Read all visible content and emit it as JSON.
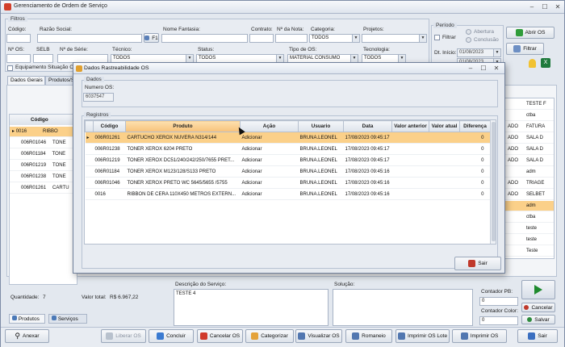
{
  "window": {
    "title": "Gerenciamento de Ordem de Serviço"
  },
  "filters": {
    "group_label": "Filtros",
    "codigo_label": "Código:",
    "razao_social_label": "Razão Social:",
    "f1_label": "F1",
    "nome_fantasia_label": "Nome Fantasia:",
    "contrato_label": "Contrato:",
    "nota_label": "Nº da Nota:",
    "categoria_label": "Categoria:",
    "categoria_value": "TODOS",
    "projetos_label": "Projetos:",
    "os_label": "Nº OS:",
    "selb_label": "SELB",
    "serie_label": "Nº de Série:",
    "tecnico_label": "Técnico:",
    "tecnico_value": "TODOS",
    "status_label": "Status:",
    "status_value": "TODOS",
    "tipo_os_label": "Tipo de OS:",
    "tipo_os_value": "MATERIAL CONSUMO",
    "tecnologia_label": "Tecnologia:",
    "tecnologia_value": "TODOS",
    "equipamento_checkbox_label": "Equipamento Situação C..."
  },
  "periodo": {
    "group_label": "Período",
    "filtrar_label": "Filtrar",
    "abertura_label": "Abertura",
    "conclusao_label": "Conclusão",
    "dt_inicio_label": "Dt. Início:",
    "dt_inicio_value": "01/08/2023",
    "dt_fim_value": "01/08/2023"
  },
  "toolbar_right": {
    "abrir_os_label": "Abrir OS",
    "filtrar_label": "Filtrar"
  },
  "main_tabs": [
    "Dados Gerais",
    "Produtos/Se..."
  ],
  "background_list": {
    "header": "Código",
    "rows": [
      {
        "code": "0016",
        "prod": "RIBBO"
      },
      {
        "code": "006R01046",
        "prod": "TONE"
      },
      {
        "code": "006R01184",
        "prod": "TONE"
      },
      {
        "code": "006R01219",
        "prod": "TONE"
      },
      {
        "code": "006R01238",
        "prod": "TONE"
      },
      {
        "code": "006R01261",
        "prod": "CARTU"
      }
    ],
    "quantidade_label": "Quantidade:",
    "quantidade_value": "7",
    "valor_total_label": "Valor total:",
    "valor_total_value": "R$ 6.967,22"
  },
  "right_list": {
    "rows": [
      {
        "col1": "",
        "col2": "TESTE F"
      },
      {
        "col1": "",
        "col2": "ctba"
      },
      {
        "col1": "ADO",
        "col2": "FATURA"
      },
      {
        "col1": "ADO",
        "col2": "SALA D"
      },
      {
        "col1": "ADO",
        "col2": "SALA D"
      },
      {
        "col1": "ADO",
        "col2": "SALA D"
      },
      {
        "col1": "",
        "col2": "adm"
      },
      {
        "col1": "ADO",
        "col2": "TRIAGE"
      },
      {
        "col1": "ADO",
        "col2": "SELBET"
      },
      {
        "col1": "",
        "col2": "adm"
      },
      {
        "col1": "",
        "col2": "ctba"
      },
      {
        "col1": "",
        "col2": "teste"
      },
      {
        "col1": "",
        "col2": "teste"
      },
      {
        "col1": "",
        "col2": "Teste"
      }
    ]
  },
  "bottom_tabs": [
    "Produtos",
    "Serviços"
  ],
  "descricao": {
    "label": "Descrição do Serviço:",
    "value": "TESTE 4"
  },
  "solucao": {
    "label": "Solução:"
  },
  "contadores": {
    "pb_label": "Contador PB:",
    "pb_value": "0",
    "color_label": "Contador Color:",
    "color_value": "0"
  },
  "side_buttons": {
    "cancelar_label": "Cancelar",
    "salvar_label": "Salvar"
  },
  "bottom_toolbar": {
    "anexar": "Anexar",
    "liberar_os": "Liberar OS",
    "concluir": "Concluir",
    "cancelar_os": "Cancelar OS",
    "categorizar": "Categorizar",
    "visualizar_os": "Visualizar OS",
    "romaneio": "Romaneio",
    "imprimir_os_lote": "Imprimir OS Lote",
    "imprimir_os": "Imprimir OS",
    "sair": "Sair"
  },
  "modal": {
    "title": "Dados Rastreabilidade OS",
    "dados_label": "Dados",
    "numero_os_label": "Numero OS:",
    "numero_os_value": "6037547",
    "registros_label": "Registros",
    "sair_label": "Sair",
    "columns": [
      "Código",
      "Produto",
      "Ação",
      "Usuario",
      "Data",
      "Valor anterior",
      "Valor atual",
      "Diferença"
    ],
    "rows": [
      {
        "codigo": "006R01261",
        "produto": "CARTUCHO XEROX NUVERA N314/144",
        "acao": "Adicionar",
        "usuario": "BRUNA.LEONEL",
        "data": "17/08/2023 09:45:17",
        "anterior": "",
        "atual": "",
        "diferenca": "0"
      },
      {
        "codigo": "006R01238",
        "produto": "TONER XEROX 6204 PRETO",
        "acao": "Adicionar",
        "usuario": "BRUNA.LEONEL",
        "data": "17/08/2023 09:45:17",
        "anterior": "",
        "atual": "",
        "diferenca": "0"
      },
      {
        "codigo": "006R01219",
        "produto": "TONER XEROX DC51/240/242/250/7655 PRET...",
        "acao": "Adicionar",
        "usuario": "BRUNA.LEONEL",
        "data": "17/08/2023 09:45:17",
        "anterior": "",
        "atual": "",
        "diferenca": "0"
      },
      {
        "codigo": "006R01184",
        "produto": "TONER XEROX M123/128/S133 PRETO",
        "acao": "Adicionar",
        "usuario": "BRUNA.LEONEL",
        "data": "17/08/2023 09:45:16",
        "anterior": "",
        "atual": "",
        "diferenca": "0"
      },
      {
        "codigo": "006R01046",
        "produto": "TONER XEROX PRETO WC 5645/5655 /5755",
        "acao": "Adicionar",
        "usuario": "BRUNA.LEONEL",
        "data": "17/08/2023 09:45:16",
        "anterior": "",
        "atual": "",
        "diferenca": "0"
      },
      {
        "codigo": "0016",
        "produto": "RIBBON DE CERA 110X450 METROS EXTERN...",
        "acao": "Adicionar",
        "usuario": "BRUNA.LEONEL",
        "data": "17/08/2023 09:45:16",
        "anterior": "",
        "atual": "",
        "diferenca": "0"
      }
    ]
  }
}
